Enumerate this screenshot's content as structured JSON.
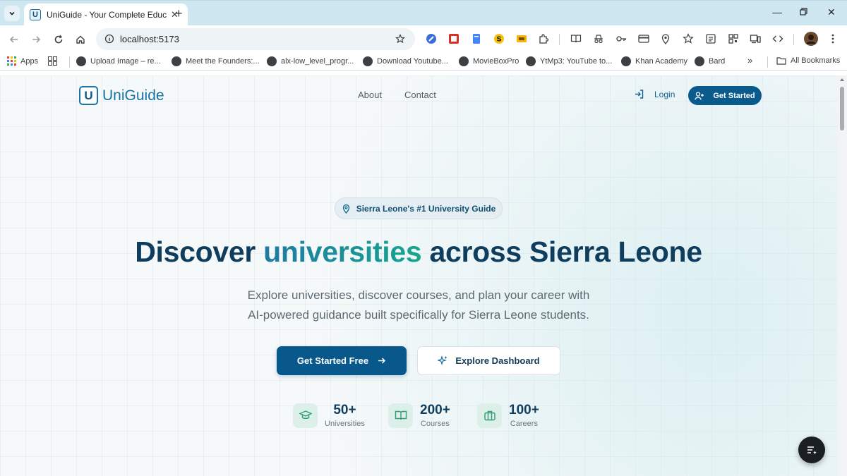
{
  "browser": {
    "tab_title": "UniGuide - Your Complete Educ",
    "favicon_letter": "U",
    "url": "localhost:5173",
    "bookmarks": [
      {
        "label": "Apps",
        "icon": "apps-grid-icon"
      },
      {
        "label": "",
        "icon": "tab-groups-icon"
      },
      {
        "label": "Upload Image – re...",
        "icon": "globe-icon"
      },
      {
        "label": "Meet the Founders:...",
        "icon": "globe-icon"
      },
      {
        "label": "alx-low_level_progr...",
        "icon": "github-icon"
      },
      {
        "label": "Download Youtube...",
        "icon": "globe-icon"
      },
      {
        "label": "MovieBoxPro",
        "icon": "globe-icon"
      },
      {
        "label": "YtMp3: YouTube to...",
        "icon": "globe-icon"
      },
      {
        "label": "Khan Academy",
        "icon": "globe-icon"
      },
      {
        "label": "Bard",
        "icon": "globe-icon"
      }
    ],
    "all_bookmarks": "All Bookmarks",
    "overflow": "»"
  },
  "nav": {
    "logo_letter": "U",
    "logo_text": "UniGuide",
    "links": [
      "About",
      "Contact"
    ],
    "login": "Login",
    "get_started": "Get Started"
  },
  "hero": {
    "badge": "Sierra Leone's #1 University Guide",
    "headline_pre": "Discover ",
    "headline_accent": "universities",
    "headline_post": " across Sierra Leone",
    "subtitle_line1": "Explore universities, discover courses, and plan your career with",
    "subtitle_line2": "AI-powered guidance built specifically for Sierra Leone students.",
    "cta_primary": "Get Started Free",
    "cta_secondary": "Explore Dashboard"
  },
  "stats": [
    {
      "value": "50+",
      "label": "Universities",
      "icon": "graduation-cap-icon"
    },
    {
      "value": "200+",
      "label": "Courses",
      "icon": "book-open-icon"
    },
    {
      "value": "100+",
      "label": "Careers",
      "icon": "briefcase-icon"
    }
  ],
  "colors": {
    "brand_primary": "#0a5a8c",
    "headline": "#0f3d5e",
    "accent_start": "#1f7aa3",
    "accent_end": "#17a58f"
  }
}
